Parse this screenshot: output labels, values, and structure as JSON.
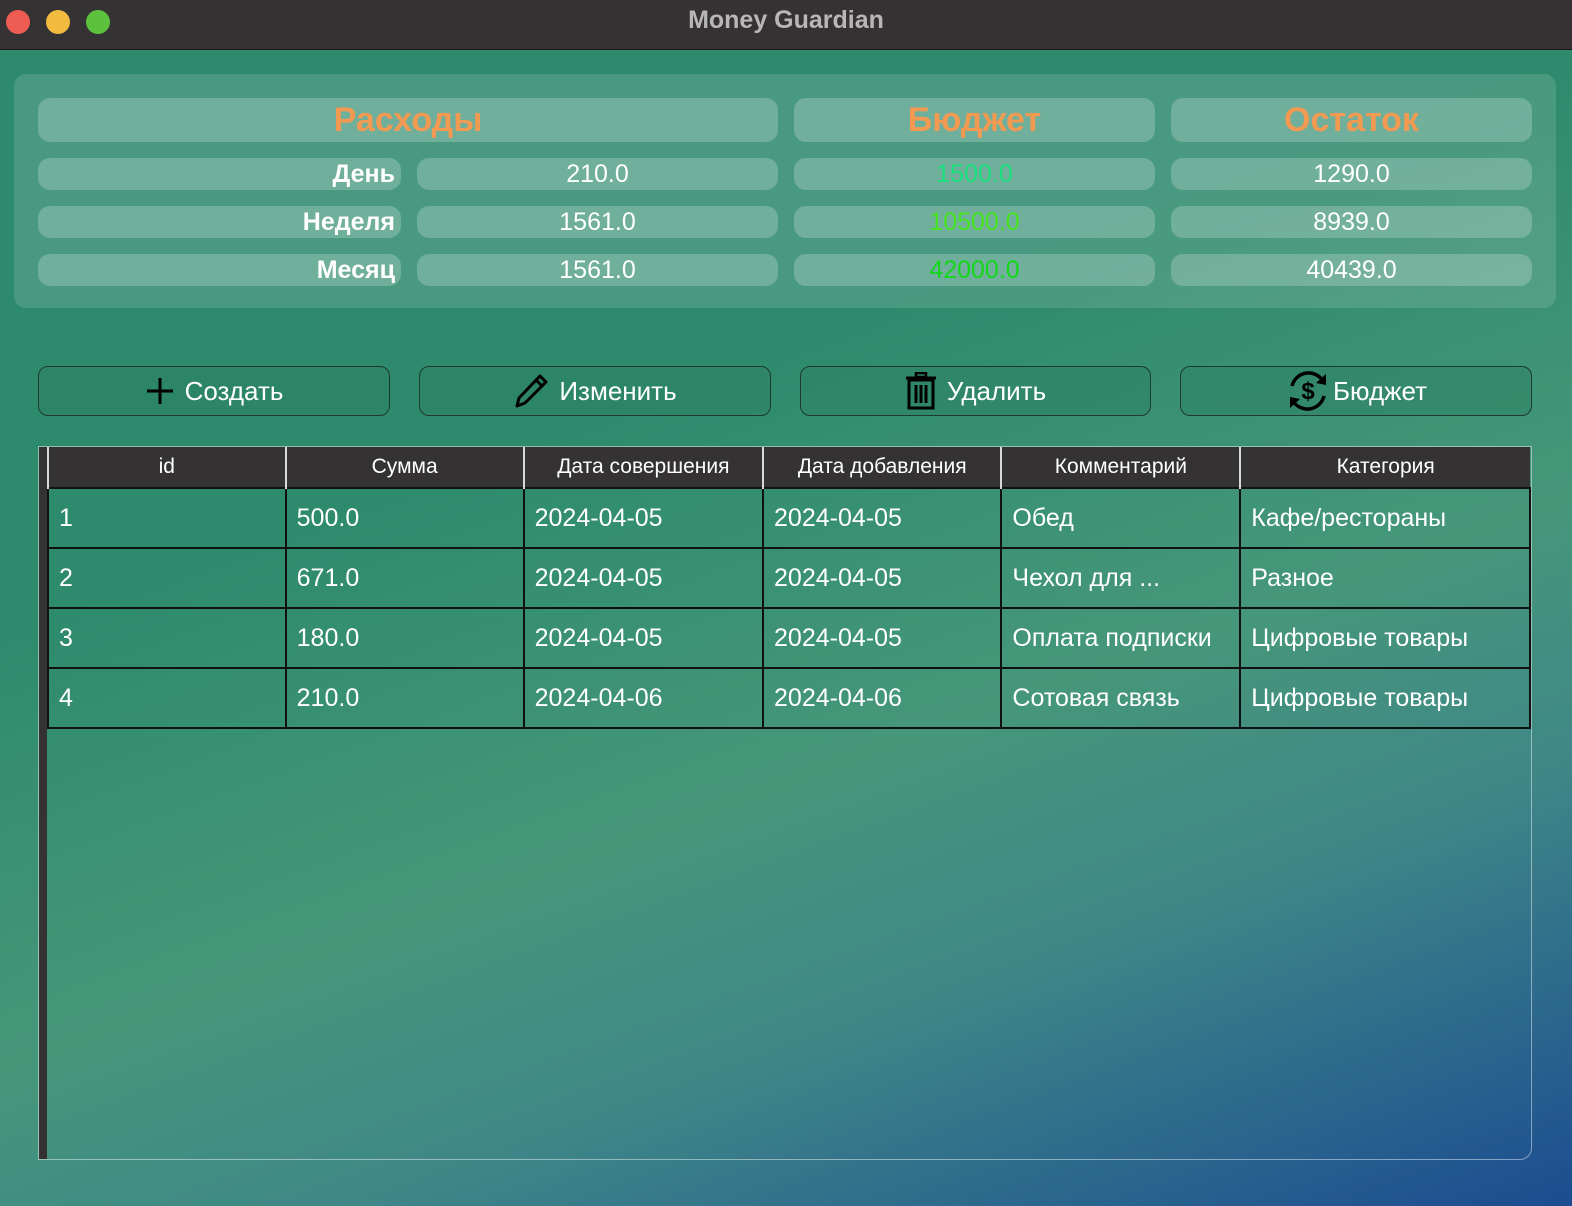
{
  "window": {
    "title": "Money Guardian"
  },
  "summary": {
    "headers": {
      "expenses": "Расходы",
      "budget": "Бюджет",
      "remainder": "Остаток"
    },
    "rows": [
      {
        "label": "День",
        "expenses": "210.0",
        "budget": "1500.0",
        "budget_color": "#17e07a",
        "remainder": "1290.0"
      },
      {
        "label": "Неделя",
        "expenses": "1561.0",
        "budget": "10500.0",
        "budget_color": "#45e61e",
        "remainder": "8939.0"
      },
      {
        "label": "Месяц",
        "expenses": "1561.0",
        "budget": "42000.0",
        "budget_color": "#12d81a",
        "remainder": "40439.0"
      }
    ],
    "header_color": "#f29a52"
  },
  "toolbar": {
    "create_label": "Создать",
    "create_icon": "plus-icon",
    "edit_label": "Изменить",
    "edit_icon": "pencil-icon",
    "delete_label": "Удалить",
    "delete_icon": "trash-icon",
    "budget_label": "Бюджет",
    "budget_icon": "dollar-refresh-icon"
  },
  "table": {
    "columns": [
      "id",
      "Сумма",
      "Дата совершения",
      "Дата добавления",
      "Комментарий",
      "Категория"
    ],
    "rows": [
      [
        "1",
        "500.0",
        "2024-04-05",
        "2024-04-05",
        "Обед",
        "Кафе/рестораны"
      ],
      [
        "2",
        "671.0",
        "2024-04-05",
        "2024-04-05",
        "Чехол для ...",
        "Разное"
      ],
      [
        "3",
        "180.0",
        "2024-04-05",
        "2024-04-05",
        "Оплата подписки",
        "Цифровые товары"
      ],
      [
        "4",
        "210.0",
        "2024-04-06",
        "2024-04-06",
        "Сотовая связь",
        "Цифровые товары"
      ]
    ]
  }
}
